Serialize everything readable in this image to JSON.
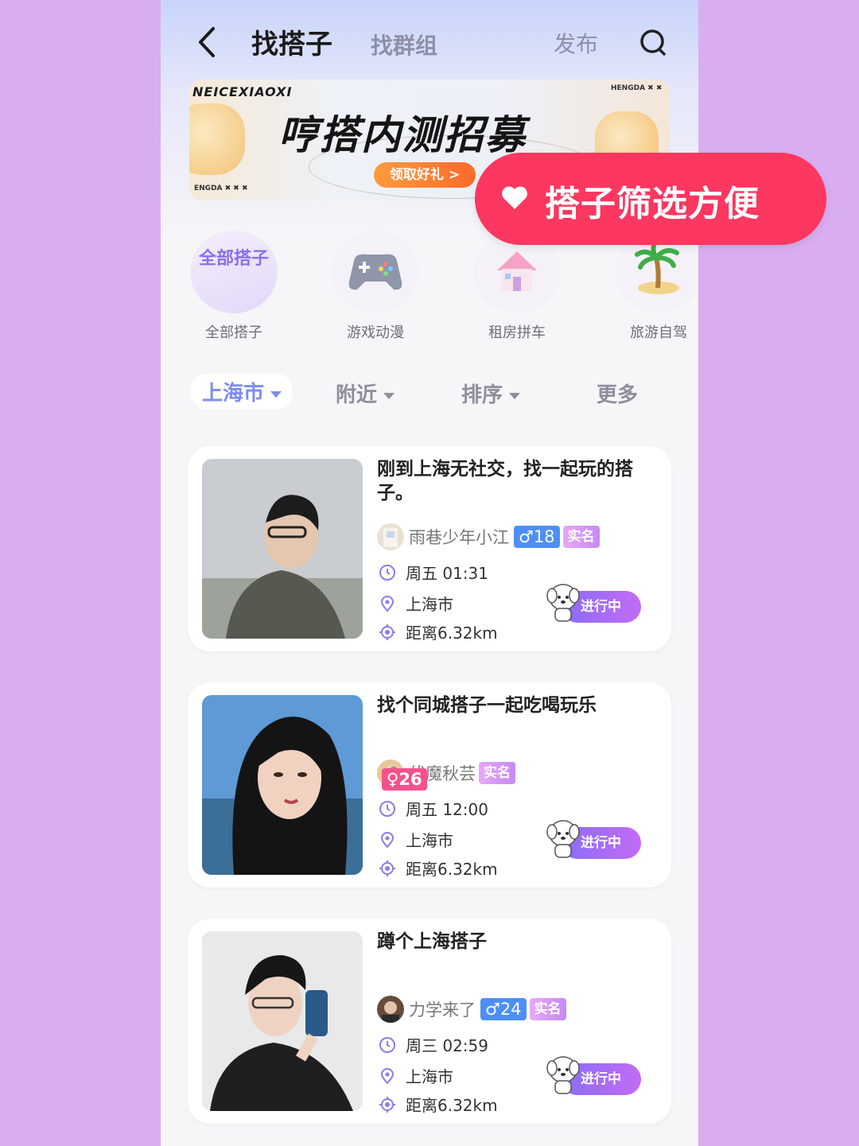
{
  "header": {
    "title": "找搭子",
    "tab_groups": "找群组",
    "publish": "发布"
  },
  "banner": {
    "brand_en": "NEICEXIAOXI",
    "tiny_right": "HENGDA ✖ ✖",
    "tiny_left": "ENGDA ✖ ✖ ✖",
    "title": "哼搭内测招募",
    "button": "领取好礼 >"
  },
  "promo": {
    "text": "搭子筛选方便",
    "color": "#fc3760"
  },
  "categories": [
    {
      "icon": "all-text",
      "label": "全部搭子",
      "circle_text": "全部搭子"
    },
    {
      "icon": "gamepad-icon",
      "label": "游戏动漫"
    },
    {
      "icon": "house-icon",
      "label": "租房拼车"
    },
    {
      "icon": "palm-tree-icon",
      "label": "旅游自驾"
    }
  ],
  "filters": {
    "city": "上海市",
    "nearby": "附近",
    "sort": "排序",
    "more": "更多"
  },
  "posts": [
    {
      "title": "刚到上海无社交，找一起玩的搭子。",
      "user": "雨巷少年小江",
      "gender": "♂18",
      "gender_type": "male",
      "verified": "实名",
      "time": "周五 01:31",
      "city": "上海市",
      "distance": "距离6.32km",
      "status": "进行中"
    },
    {
      "title": "找个同城搭子一起吃喝玩乐",
      "user": "伏魔秋芸",
      "gender": "♀26",
      "gender_type": "female",
      "verified": "实名",
      "time": "周五 12:00",
      "city": "上海市",
      "distance": "距离6.32km",
      "status": "进行中"
    },
    {
      "title": "蹲个上海搭子",
      "user": "力学来了",
      "gender": "♂24",
      "gender_type": "male",
      "verified": "实名",
      "time": "周三 02:59",
      "city": "上海市",
      "distance": "距离6.32km",
      "status": "进行中"
    }
  ],
  "colors": {
    "accent": "#8a6cf7",
    "background": "#d9aef0"
  }
}
